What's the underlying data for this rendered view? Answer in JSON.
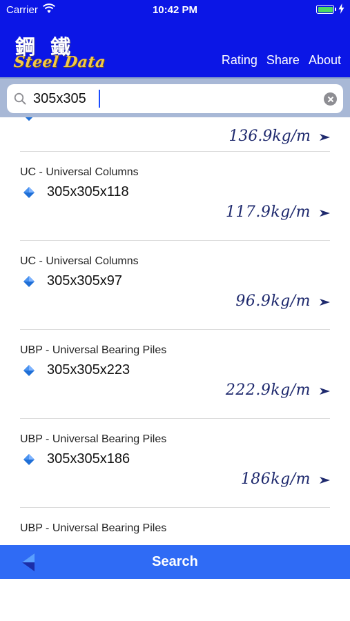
{
  "status_bar": {
    "carrier": "Carrier",
    "time": "10:42 PM"
  },
  "header": {
    "logo_chinese": "鋼 鐵",
    "logo_english": "Steel Data",
    "nav": [
      "Rating",
      "Share",
      "About"
    ]
  },
  "search": {
    "value": "305x305",
    "placeholder": ""
  },
  "results": {
    "partial_first": {
      "weight": "136.9kg/m"
    },
    "items": [
      {
        "category": "UC - Universal Columns",
        "name": "305x305x118",
        "weight": "117.9kg/m"
      },
      {
        "category": "UC - Universal Columns",
        "name": "305x305x97",
        "weight": "96.9kg/m"
      },
      {
        "category": "UBP - Universal Bearing Piles",
        "name": "305x305x223",
        "weight": "222.9kg/m"
      },
      {
        "category": "UBP - Universal Bearing Piles",
        "name": "305x305x186",
        "weight": "186kg/m"
      },
      {
        "category": "UBP - Universal Bearing Piles",
        "name": "",
        "weight": ""
      }
    ]
  },
  "bottom_bar": {
    "title": "Search"
  },
  "colors": {
    "header_blue": "#0b16e6",
    "bar_blue": "#2f6bf5",
    "weight_ink": "#1f2a6e"
  },
  "icons": [
    "wifi-icon",
    "battery-icon",
    "charging-icon",
    "search-icon",
    "clear-icon",
    "diamond-icon",
    "chevron-right-icon",
    "back-arrow-icon"
  ]
}
